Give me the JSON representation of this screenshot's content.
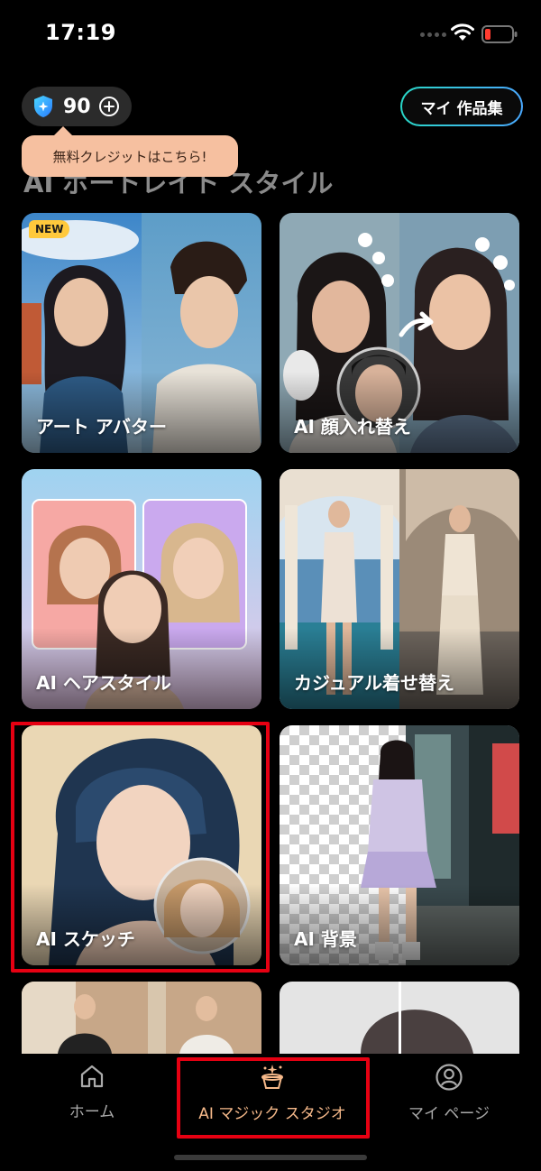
{
  "status_bar": {
    "time": "17:19",
    "icons": [
      "wifi-icon",
      "battery-icon"
    ],
    "battery_color": "#ff3b30"
  },
  "header": {
    "credits": "90",
    "credit_icon": "shield-star-icon",
    "add_icon": "plus-circle-icon",
    "my_works_label": "マイ 作品集",
    "section_title": "AI ポートレイト スタイル",
    "tooltip": "無料クレジットはこちら!"
  },
  "cards": [
    {
      "label": "アート アバター",
      "badge": "NEW"
    },
    {
      "label": "AI 顔入れ替え"
    },
    {
      "label": "AI ヘアスタイル"
    },
    {
      "label": "カジュアル着せ替え"
    },
    {
      "label": "AI スケッチ"
    },
    {
      "label": "AI 背景"
    }
  ],
  "bottom_nav": [
    {
      "label": "ホーム",
      "icon": "home-icon"
    },
    {
      "label": "AI マジック スタジオ",
      "icon": "magic-hat-icon",
      "active": true
    },
    {
      "label": "マイ ページ",
      "icon": "user-circle-icon"
    }
  ],
  "colors": {
    "accent": "#f6b98a",
    "highlight": "#e60012",
    "my_works_border": "#29d7c7"
  }
}
